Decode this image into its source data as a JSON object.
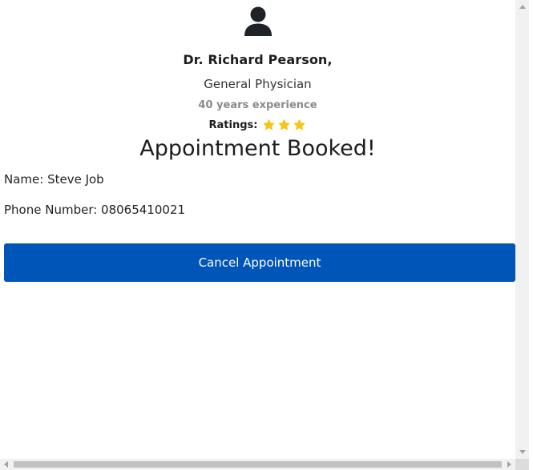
{
  "doctor": {
    "avatar_icon": "user-icon",
    "name": "Dr. Richard Pearson,",
    "specialty": "General Physician",
    "experience": "40 years experience",
    "ratings_label": "Ratings:",
    "rating_value": 3,
    "star_color": "#f5c518"
  },
  "booking": {
    "title": "Appointment Booked!",
    "name_line": "Name: Steve Job",
    "phone_line": "Phone Number: 08065410021",
    "cancel_label": "Cancel Appointment",
    "cancel_color": "#0055b8"
  }
}
